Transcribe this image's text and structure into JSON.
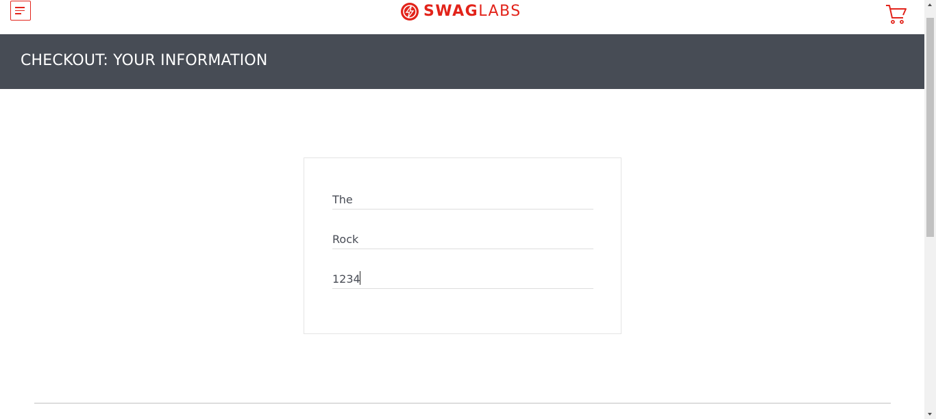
{
  "header": {
    "logo": {
      "bold": "SWAG",
      "light": "LABS"
    },
    "menu_icon": "hamburger-menu-icon",
    "cart_icon": "shopping-cart-icon"
  },
  "subheader": {
    "title": "CHECKOUT: YOUR INFORMATION"
  },
  "form": {
    "first_name": "The",
    "last_name": "Rock",
    "postal_code": "1234"
  },
  "colors": {
    "brand": "#e2231a",
    "subheader_bg": "#474c55",
    "text": "#484c55"
  }
}
